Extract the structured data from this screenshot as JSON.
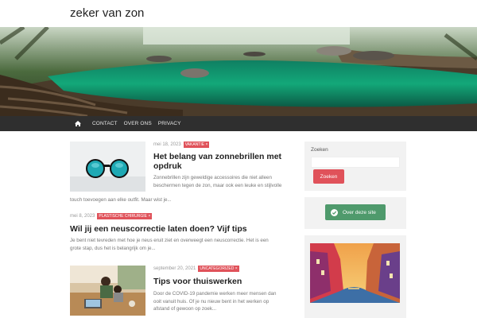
{
  "site": {
    "title": "zeker van zon"
  },
  "nav": {
    "items": [
      "CONTACT",
      "OVER ONS",
      "PRIVACY"
    ]
  },
  "posts": [
    {
      "date": "mei 18, 2023",
      "category": "VAKANTIE",
      "title_lines": [
        "Het belang van zonnebrillen met",
        "opdruk"
      ],
      "excerpt_lines": [
        "Zonnebrillen zijn geweldige accessoires die niet alleen",
        "beschermen tegen de zon, maar ook een leuke en stijlvolle",
        "touch toevoegen aan elke outfit. Maar wist je..."
      ]
    },
    {
      "date": "mei 8, 2023",
      "category": "PLASTISCHE CHIRURGIE",
      "title": "Wil jij een neuscorrectie laten doen? Vijf tips",
      "excerpt_lines": [
        "Je bent niet tevreden met hoe je neus eruit ziet en overweegt een neuscorrectie. Het is een",
        "grote stap, dus het is belangrijk om je..."
      ]
    },
    {
      "date": "september 20, 2021",
      "category": "UNCATEGORIZED",
      "title": "Tips voor thuiswerken",
      "excerpt_lines": [
        "Door de COVID-19 pandemie werken meer mensen dan",
        "ooit vanuit huis. Of je nu nieuw bent in het werken op",
        "afstand of gewoon op zoek..."
      ]
    }
  ],
  "sidebar": {
    "search_label": "Zoeken",
    "search_placeholder": "",
    "search_button": "Zoeken",
    "about_button": "Over deze site"
  },
  "colors": {
    "accent": "#e0525a",
    "nav_bg": "#2f2f2f",
    "about_green": "#4f9a6c"
  },
  "icons": {
    "home": "home-icon",
    "about": "check-circle-icon",
    "category_close": "close-icon"
  }
}
